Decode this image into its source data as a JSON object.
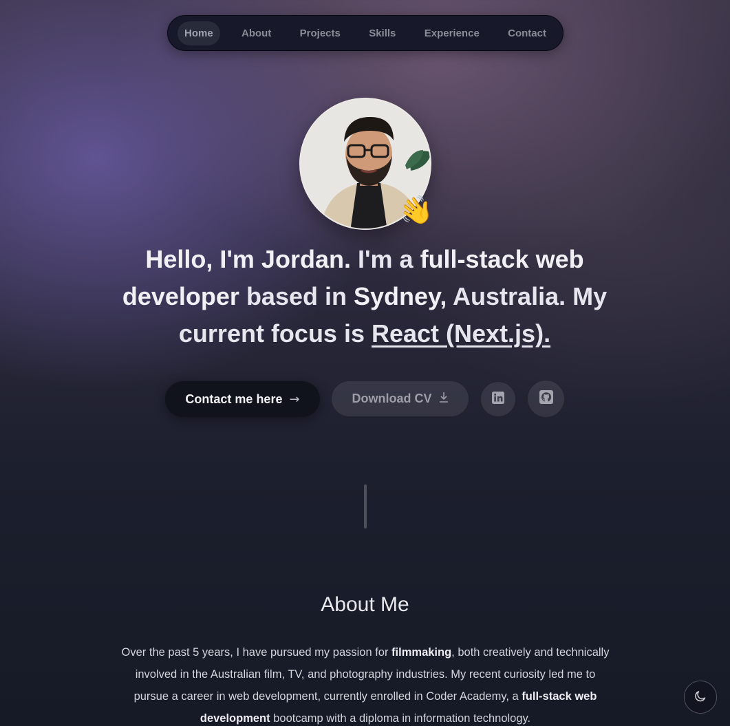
{
  "nav": {
    "items": [
      {
        "label": "Home",
        "active": true
      },
      {
        "label": "About",
        "active": false
      },
      {
        "label": "Projects",
        "active": false
      },
      {
        "label": "Skills",
        "active": false
      },
      {
        "label": "Experience",
        "active": false
      },
      {
        "label": "Contact",
        "active": false
      }
    ]
  },
  "hero": {
    "avatar_alt": "profile photo",
    "wave_emoji": "👋",
    "headline": {
      "greeting": "Hello, I'm Jordan.",
      "text1": " I'm a ",
      "role": "full-stack web developer",
      "text2": " based in ",
      "city": "Sydney",
      "text3": ", Australia. My current focus is ",
      "focus": "React (Next.js)."
    },
    "contact_button": "Contact me here",
    "contact_icon": "→",
    "cv_button": "Download CV",
    "cv_icon": "download-icon",
    "linkedin_icon": "linkedin-icon",
    "github_icon": "github-icon"
  },
  "about": {
    "title": "About Me",
    "p1_a": "Over the past 5 years, I have pursued my passion for ",
    "p1_b": "filmmaking",
    "p1_c": ", both creatively and technically involved in the Australian film, TV, and photography industries. My recent curiosity led me to pursue a career in web development, currently enrolled in Coder Academy, a ",
    "p1_d": "full-stack web development",
    "p1_e": " bootcamp with a diploma in information technology."
  },
  "colors": {
    "background": "#161a26",
    "nav_bg": "#17192a",
    "accent_purple": "#685aa0",
    "button_dark": "#11131c"
  },
  "theme_toggle_icon": "moon-icon"
}
